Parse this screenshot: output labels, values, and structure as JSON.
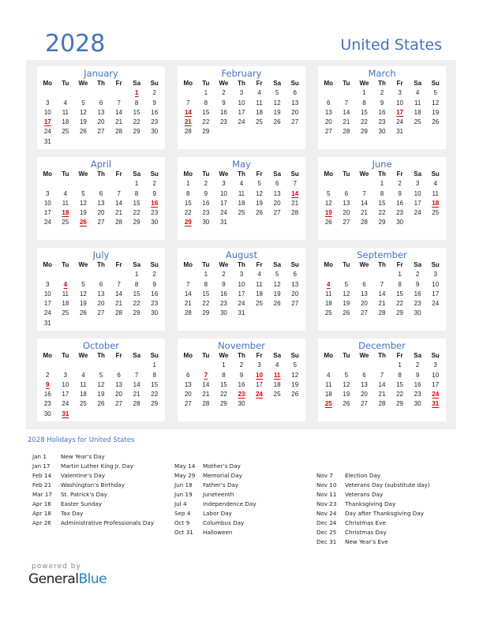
{
  "header": {
    "year": "2028",
    "country": "United States"
  },
  "weekday_labels": [
    "Mo",
    "Tu",
    "We",
    "Th",
    "Fr",
    "Sa",
    "Su"
  ],
  "months": [
    {
      "name": "January",
      "offset": 5,
      "days": 31,
      "holidays": [
        1,
        17
      ]
    },
    {
      "name": "February",
      "offset": 1,
      "days": 29,
      "holidays": [
        14,
        21
      ]
    },
    {
      "name": "March",
      "offset": 2,
      "days": 31,
      "holidays": [
        17
      ]
    },
    {
      "name": "April",
      "offset": 5,
      "days": 30,
      "holidays": [
        16,
        18,
        26
      ]
    },
    {
      "name": "May",
      "offset": 0,
      "days": 31,
      "holidays": [
        14,
        29
      ]
    },
    {
      "name": "June",
      "offset": 3,
      "days": 30,
      "holidays": [
        18,
        19
      ]
    },
    {
      "name": "July",
      "offset": 5,
      "days": 31,
      "holidays": [
        4
      ]
    },
    {
      "name": "August",
      "offset": 1,
      "days": 31,
      "holidays": []
    },
    {
      "name": "September",
      "offset": 4,
      "days": 30,
      "holidays": [
        4
      ]
    },
    {
      "name": "October",
      "offset": 6,
      "days": 31,
      "holidays": [
        9,
        31
      ]
    },
    {
      "name": "November",
      "offset": 2,
      "days": 30,
      "holidays": [
        7,
        10,
        11,
        23,
        24
      ]
    },
    {
      "name": "December",
      "offset": 4,
      "days": 31,
      "holidays": [
        24,
        25,
        31
      ]
    }
  ],
  "holidays_title": "2028 Holidays for United States",
  "holiday_columns": [
    [
      {
        "date": "Jan 1",
        "name": "New Year’s Day"
      },
      {
        "date": "Jan 17",
        "name": "Martin Luther King Jr. Day"
      },
      {
        "date": "Feb 14",
        "name": "Valentine’s Day"
      },
      {
        "date": "Feb 21",
        "name": "Washington’s Birthday"
      },
      {
        "date": "Mar 17",
        "name": "St. Patrick’s Day"
      },
      {
        "date": "Apr 16",
        "name": "Easter Sunday"
      },
      {
        "date": "Apr 18",
        "name": "Tax Day"
      },
      {
        "date": "Apr 26",
        "name": "Administrative Professionals Day"
      }
    ],
    [
      {
        "date": "May 14",
        "name": "Mother’s Day"
      },
      {
        "date": "May 29",
        "name": "Memorial Day"
      },
      {
        "date": "Jun 18",
        "name": "Father’s Day"
      },
      {
        "date": "Jun 19",
        "name": "Juneteenth"
      },
      {
        "date": "Jul 4",
        "name": "Independence Day"
      },
      {
        "date": "Sep 4",
        "name": "Labor Day"
      },
      {
        "date": "Oct 9",
        "name": "Columbus Day"
      },
      {
        "date": "Oct 31",
        "name": "Halloween"
      }
    ],
    [
      {
        "date": "Nov 7",
        "name": "Election Day"
      },
      {
        "date": "Nov 10",
        "name": "Veterans Day (substitute day)"
      },
      {
        "date": "Nov 11",
        "name": "Veterans Day"
      },
      {
        "date": "Nov 23",
        "name": "Thanksgiving Day"
      },
      {
        "date": "Nov 24",
        "name": "Day after Thanksgiving Day"
      },
      {
        "date": "Dec 24",
        "name": "Christmas Eve"
      },
      {
        "date": "Dec 25",
        "name": "Christmas Day"
      },
      {
        "date": "Dec 31",
        "name": "New Year’s Eve"
      }
    ]
  ],
  "footer": {
    "powered_by": "powered by",
    "brand_general": "General",
    "brand_blue": "Blue"
  },
  "colors": {
    "accent": "#4472c4",
    "holiday": "#e00000",
    "panel": "#efefef",
    "brand_blue": "#1f7fc4"
  }
}
